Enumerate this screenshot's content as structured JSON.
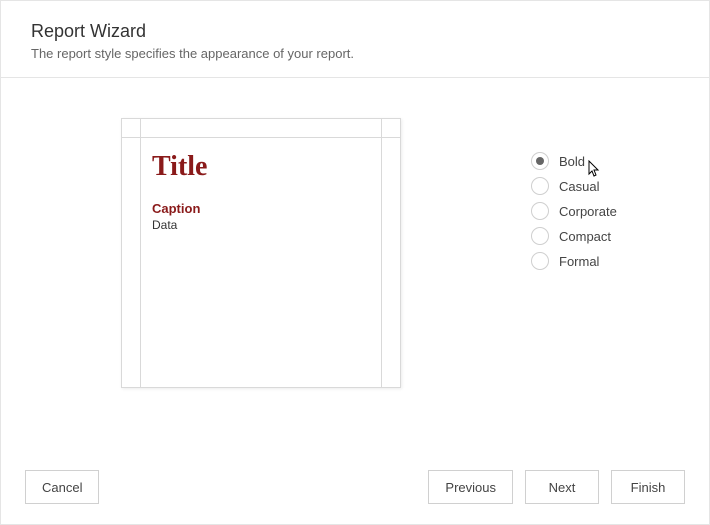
{
  "header": {
    "title": "Report Wizard",
    "subtitle": "The report style specifies the appearance of your report."
  },
  "preview": {
    "title": "Title",
    "caption": "Caption",
    "data": "Data"
  },
  "styles": {
    "options": [
      {
        "label": "Bold",
        "selected": true
      },
      {
        "label": "Casual",
        "selected": false
      },
      {
        "label": "Corporate",
        "selected": false
      },
      {
        "label": "Compact",
        "selected": false
      },
      {
        "label": "Formal",
        "selected": false
      }
    ]
  },
  "footer": {
    "cancel": "Cancel",
    "previous": "Previous",
    "next": "Next",
    "finish": "Finish"
  },
  "colors": {
    "accent": "#8a1a1a"
  }
}
